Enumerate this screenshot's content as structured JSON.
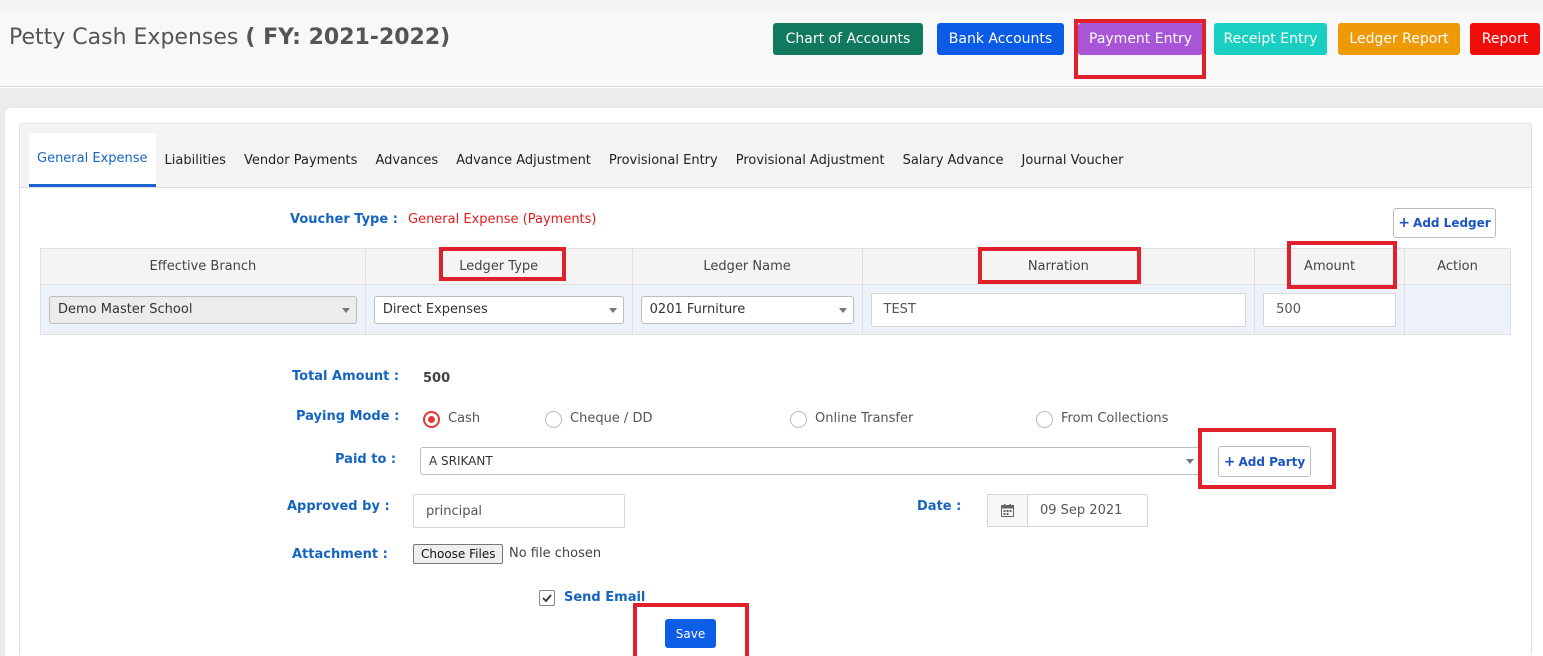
{
  "header": {
    "title": "Petty Cash Expenses",
    "fy": "( FY: 2021-2022)",
    "buttons": [
      {
        "label": "Chart of Accounts",
        "color": "#117a5e"
      },
      {
        "label": "Bank Accounts",
        "color": "#0a5be6"
      },
      {
        "label": "Payment Entry",
        "color": "#a855d8"
      },
      {
        "label": "Receipt Entry",
        "color": "#19cfc2"
      },
      {
        "label": "Ledger Report",
        "color": "#ee9a07"
      },
      {
        "label": "Report",
        "color": "#f20d0d"
      }
    ]
  },
  "tabs": [
    "General Expense",
    "Liabilities",
    "Vendor Payments",
    "Advances",
    "Advance Adjustment",
    "Provisional Entry",
    "Provisional Adjustment",
    "Salary Advance",
    "Journal Voucher"
  ],
  "form": {
    "voucher_type_label": "Voucher Type :",
    "voucher_type_value": "General Expense (Payments)",
    "add_ledger": "Add Ledger",
    "table": {
      "headers": [
        "Effective Branch",
        "Ledger Type",
        "Ledger Name",
        "Narration",
        "Amount",
        "Action"
      ],
      "row": {
        "branch": "Demo Master School",
        "ledger_type": "Direct Expenses",
        "ledger_name": "0201 Furniture",
        "narration": "TEST",
        "amount": "500"
      }
    },
    "total_amount_label": "Total Amount :",
    "total_amount": "500",
    "paying_mode_label": "Paying Mode :",
    "paying_modes": [
      "Cash",
      "Cheque / DD",
      "Online Transfer",
      "From Collections"
    ],
    "paying_mode_selected": "Cash",
    "paid_to_label": "Paid to :",
    "paid_to": "A SRIKANT",
    "add_party": "Add Party",
    "approved_by_label": "Approved by :",
    "approved_by": "principal",
    "date_label": "Date :",
    "date": "09 Sep 2021",
    "attachment_label": "Attachment :",
    "choose_files": "Choose Files",
    "no_file": "No file chosen",
    "send_email": "Send Email",
    "save": "Save"
  }
}
